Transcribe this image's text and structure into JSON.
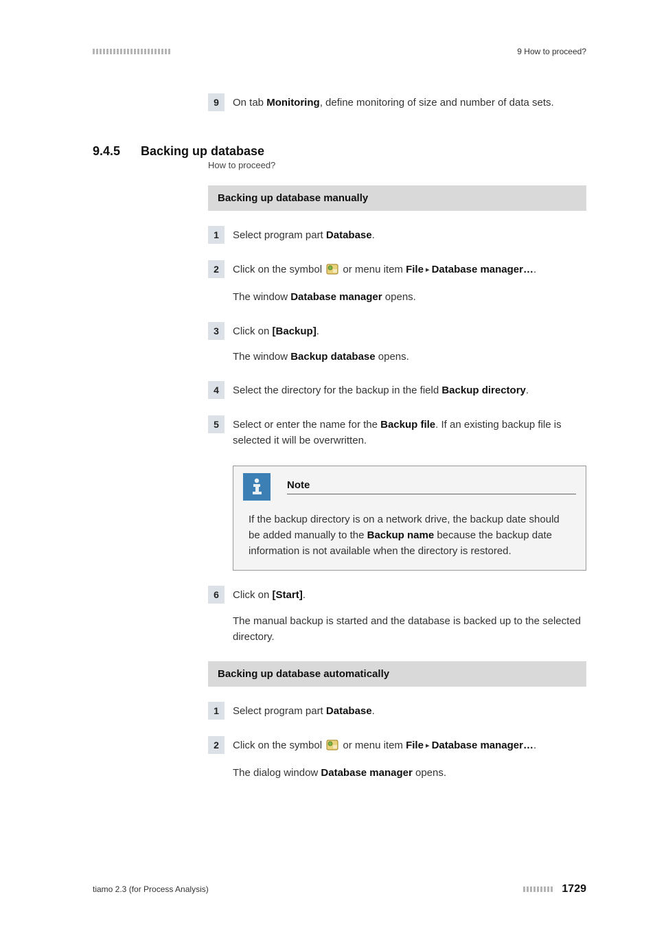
{
  "header": {
    "chapter": "9 How to proceed?"
  },
  "intro_step": {
    "num": "9",
    "text_pre": "On tab ",
    "text_bold": "Monitoring",
    "text_post": ", define monitoring of size and number of data sets."
  },
  "section": {
    "num": "9.4.5",
    "title": "Backing up database",
    "subtitle": "How to proceed?"
  },
  "group1": {
    "title": "Backing up database manually",
    "steps": {
      "s1": {
        "num": "1",
        "pre": "Select program part ",
        "b1": "Database",
        "post": "."
      },
      "s2": {
        "num": "2",
        "pre": "Click on the symbol ",
        "mid": " or menu item ",
        "b1": "File",
        "tri": " ▸ ",
        "b2": "Database manager…",
        "post": ".",
        "follow_pre": "The window ",
        "follow_b": "Database manager",
        "follow_post": " opens."
      },
      "s3": {
        "num": "3",
        "pre": "Click on ",
        "b1": "[Backup]",
        "post": ".",
        "follow_pre": "The window ",
        "follow_b": "Backup database",
        "follow_post": " opens."
      },
      "s4": {
        "num": "4",
        "pre": "Select the directory for the backup in the field ",
        "b1": "Backup directory",
        "post": "."
      },
      "s5": {
        "num": "5",
        "pre": "Select or enter the name for the ",
        "b1": "Backup file",
        "post": ". If an existing backup file is selected it will be overwritten."
      },
      "note": {
        "title": "Note",
        "body_pre": "If the backup directory is on a network drive, the backup date should be added manually to the ",
        "body_b": "Backup name",
        "body_post": " because the backup date information is not available when the directory is restored."
      },
      "s6": {
        "num": "6",
        "pre": "Click on ",
        "b1": "[Start]",
        "post": ".",
        "follow": "The manual backup is started and the database is backed up to the selected directory."
      }
    }
  },
  "group2": {
    "title": "Backing up database automatically",
    "steps": {
      "s1": {
        "num": "1",
        "pre": "Select program part ",
        "b1": "Database",
        "post": "."
      },
      "s2": {
        "num": "2",
        "pre": "Click on the symbol ",
        "mid": " or menu item ",
        "b1": "File",
        "tri": " ▸ ",
        "b2": "Database manager…",
        "post": ".",
        "follow_pre": "The dialog window ",
        "follow_b": "Database manager",
        "follow_post": " opens."
      }
    }
  },
  "footer": {
    "left": "tiamo 2.3 (for Process Analysis)",
    "page": "1729"
  }
}
